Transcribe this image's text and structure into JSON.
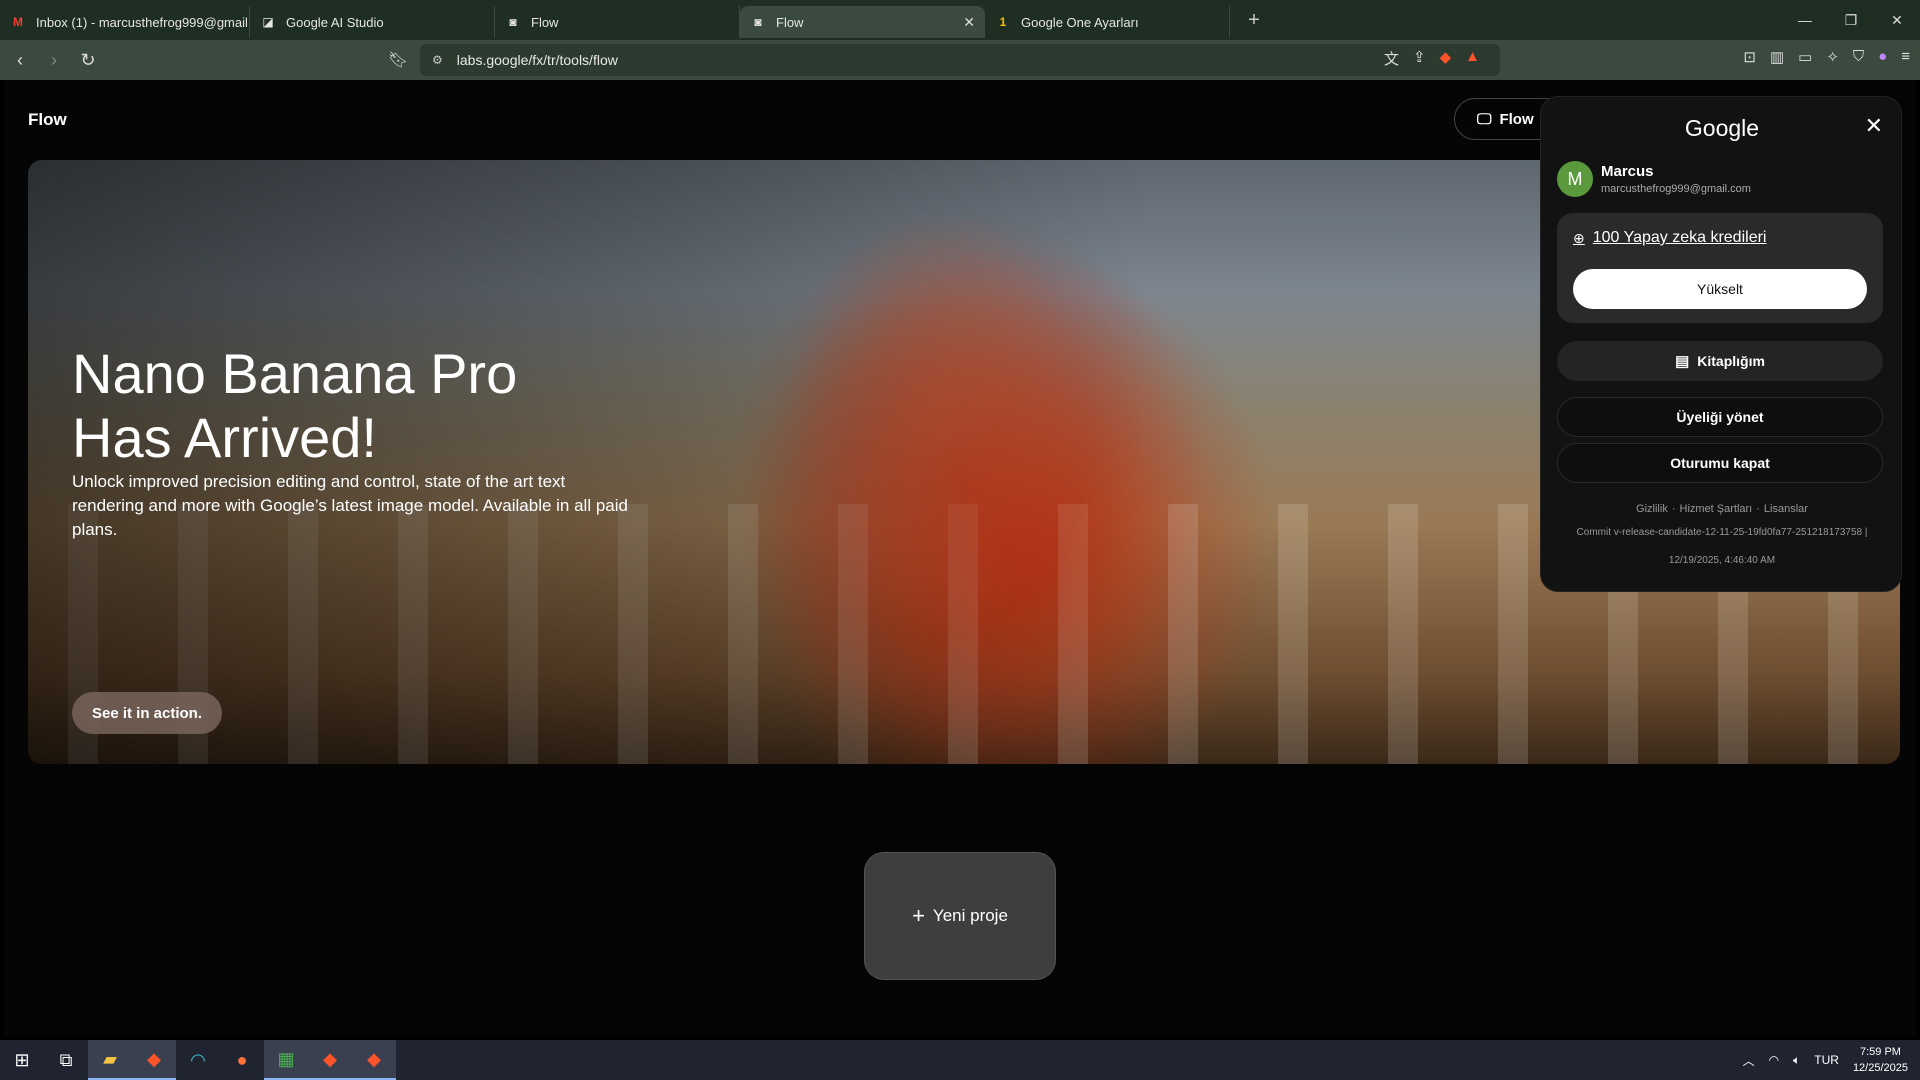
{
  "browser": {
    "tabs": [
      {
        "label": "Inbox (1) - marcusthefrog999@gmail",
        "icon": "gmail-icon"
      },
      {
        "label": "Google AI Studio",
        "icon": "ai-studio-icon"
      },
      {
        "label": "Flow",
        "icon": "flow-icon"
      },
      {
        "label": "Flow",
        "icon": "flow-icon",
        "active": true
      },
      {
        "label": "Google One Ayarları",
        "icon": "google-one-icon"
      }
    ],
    "url": "labs.google/fx/tr/tools/flow"
  },
  "page": {
    "app_title": "Flow",
    "flow_pill_label": "Flow",
    "hero": {
      "title_line1": "Nano Banana Pro",
      "title_line2": "Has Arrived!",
      "subtitle": "Unlock improved precision editing and control, state of the art text rendering and more with Google’s latest image model. Available in all paid plans.",
      "cta": "See it in action."
    },
    "new_project_label": "Yeni proje"
  },
  "account_menu": {
    "brand": "Google",
    "avatar_letter": "M",
    "name": "Marcus",
    "email": "marcusthefrog999@gmail.com",
    "credits": "100 Yapay zeka kredileri",
    "upgrade": "Yükselt",
    "library": "Kitaplığım",
    "manage": "Üyeliği yönet",
    "signout": "Oturumu kapat",
    "legal": [
      "Gizlilik",
      "Hizmet Şartları",
      "Lisanslar"
    ],
    "commit": "Commit v-release-candidate-12-11-25-19fd0fa77-251218173758 |",
    "commit_date": "12/19/2025, 4:46:40 AM"
  },
  "taskbar": {
    "lang": "TUR",
    "time": "7:59 PM",
    "date": "12/25/2025"
  },
  "colors": {
    "tab_bar": "#1e2e22",
    "toolbar": "#3a4a3e",
    "avatar": "#5a9a3c"
  }
}
